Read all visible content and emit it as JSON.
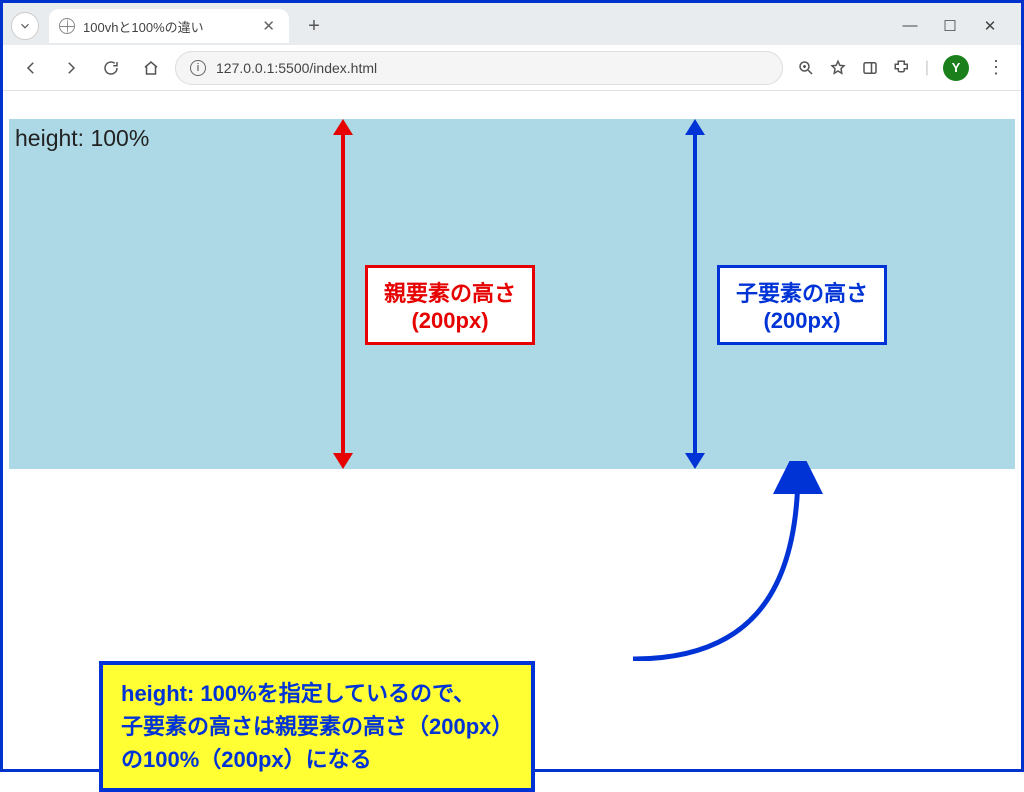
{
  "window": {
    "minimize": "—",
    "maximize": "☐",
    "close": "✕"
  },
  "tab": {
    "title": "100vhと100%の違い",
    "close": "✕",
    "newtab": "+"
  },
  "toolbar": {
    "url": "127.0.0.1:5500/index.html",
    "avatar_letter": "Y",
    "menu": "⋮"
  },
  "content": {
    "heading": "height: 100%",
    "parent_label": "親要素の高さ\n(200px)",
    "child_label": "子要素の高さ\n(200px)",
    "explain": "height: 100%を指定しているので、\n子要素の高さは親要素の高さ（200px）\nの100%（200px）になる"
  }
}
